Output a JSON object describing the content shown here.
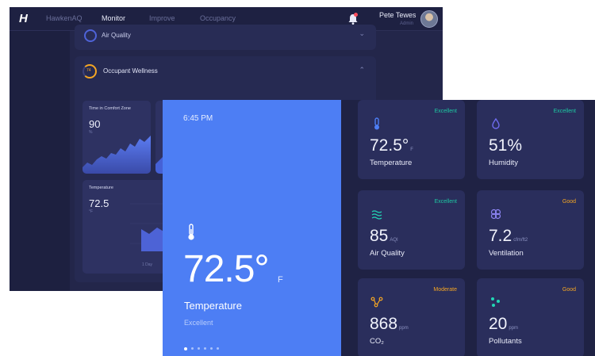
{
  "app": {
    "nav": [
      "HawkenAQ",
      "Monitor",
      "Improve",
      "Occupancy"
    ],
    "active_nav": "Monitor",
    "user": {
      "name": "Pete Tewes",
      "role": "Admin"
    }
  },
  "dashboard": {
    "air_quality_card_title": "Air Quality",
    "occupant_wellness": {
      "title": "Occupant Wellness",
      "score": "74"
    },
    "comfort": {
      "label": "Time in Comfort Zone",
      "value": "90",
      "unit": "%"
    },
    "temperature_mini": {
      "label": "Temperature",
      "value": "72.5",
      "unit": "°F",
      "chart_tag": "1 Day"
    }
  },
  "hero": {
    "time": "6:45 PM",
    "value": "72.5°",
    "unit": "F",
    "label": "Temperature",
    "status": "Excellent",
    "page_count": 6,
    "active_page": 0
  },
  "metrics": [
    {
      "label": "Temperature",
      "value": "72.5°",
      "unit": "F",
      "status": "Excellent",
      "status_color": "#1dc7a2",
      "icon": "thermometer-icon",
      "icon_color": "#4d7ef4"
    },
    {
      "label": "Humidity",
      "value": "51%",
      "unit": "",
      "status": "Excellent",
      "status_color": "#1dc7a2",
      "icon": "droplet-icon",
      "icon_color": "#6f6cf0"
    },
    {
      "label": "Air Quality",
      "value": "85",
      "unit": "AQI",
      "status": "Excellent",
      "status_color": "#1dc7a2",
      "icon": "wind-waves-icon",
      "icon_color": "#22d6b4"
    },
    {
      "label": "Ventilation",
      "value": "7.2",
      "unit": "cfm/ft2",
      "status": "Good",
      "status_color": "#f5a623",
      "icon": "fan-icon",
      "icon_color": "#8f86f5"
    },
    {
      "label": "CO₂",
      "value": "868",
      "unit": "ppm",
      "status": "Moderate",
      "status_color": "#f5a623",
      "icon": "molecule-icon",
      "icon_color": "#f5a623"
    },
    {
      "label": "Pollutants",
      "value": "20",
      "unit": "ppm",
      "status": "Good",
      "status_color": "#f5a623",
      "icon": "particles-icon",
      "icon_color": "#22d6b4"
    }
  ]
}
